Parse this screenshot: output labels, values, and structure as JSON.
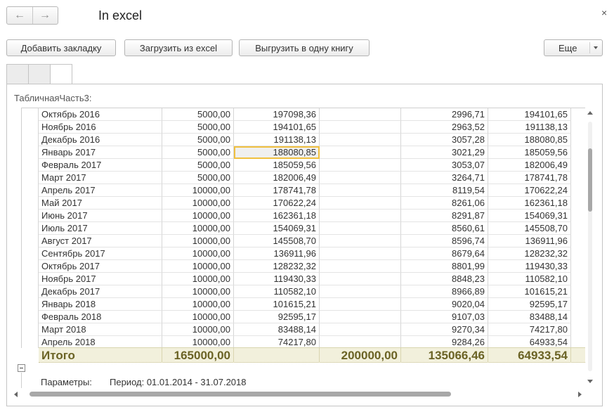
{
  "window": {
    "title": "In excel",
    "back_icon": "arrow-left-icon",
    "forward_icon": "arrow-right-icon",
    "close_glyph": "×"
  },
  "toolbar": {
    "add_bookmark": "Добавить закладку",
    "load_excel": "Загрузить из excel",
    "export_one_book": "Выгрузить в одну книгу",
    "more": "Еще"
  },
  "section": {
    "label": "ТабличнаяЧасть3:"
  },
  "table": {
    "rows": [
      [
        "Октябрь 2016",
        "5000,00",
        "197098,36",
        "",
        "2996,71",
        "194101,65"
      ],
      [
        "Ноябрь 2016",
        "5000,00",
        "194101,65",
        "",
        "2963,52",
        "191138,13"
      ],
      [
        "Декабрь 2016",
        "5000,00",
        "191138,13",
        "",
        "3057,28",
        "188080,85"
      ],
      [
        "Январь 2017",
        "5000,00",
        "188080,85",
        "",
        "3021,29",
        "185059,56"
      ],
      [
        "Февраль 2017",
        "5000,00",
        "185059,56",
        "",
        "3053,07",
        "182006,49"
      ],
      [
        "Март 2017",
        "5000,00",
        "182006,49",
        "",
        "3264,71",
        "178741,78"
      ],
      [
        "Апрель 2017",
        "10000,00",
        "178741,78",
        "",
        "8119,54",
        "170622,24"
      ],
      [
        "Май 2017",
        "10000,00",
        "170622,24",
        "",
        "8261,06",
        "162361,18"
      ],
      [
        "Июнь 2017",
        "10000,00",
        "162361,18",
        "",
        "8291,87",
        "154069,31"
      ],
      [
        "Июль 2017",
        "10000,00",
        "154069,31",
        "",
        "8560,61",
        "145508,70"
      ],
      [
        "Август 2017",
        "10000,00",
        "145508,70",
        "",
        "8596,74",
        "136911,96"
      ],
      [
        "Сентябрь 2017",
        "10000,00",
        "136911,96",
        "",
        "8679,64",
        "128232,32"
      ],
      [
        "Октябрь 2017",
        "10000,00",
        "128232,32",
        "",
        "8801,99",
        "119430,33"
      ],
      [
        "Ноябрь 2017",
        "10000,00",
        "119430,33",
        "",
        "8848,23",
        "110582,10"
      ],
      [
        "Декабрь 2017",
        "10000,00",
        "110582,10",
        "",
        "8966,89",
        "101615,21"
      ],
      [
        "Январь 2018",
        "10000,00",
        "101615,21",
        "",
        "9020,04",
        "92595,17"
      ],
      [
        "Февраль 2018",
        "10000,00",
        "92595,17",
        "",
        "9107,03",
        "83488,14"
      ],
      [
        "Март 2018",
        "10000,00",
        "83488,14",
        "",
        "9270,34",
        "74217,80"
      ],
      [
        "Апрель 2018",
        "10000,00",
        "74217,80",
        "",
        "9284,26",
        "64933,54"
      ]
    ],
    "selected": {
      "row": 3,
      "col": 2
    },
    "totals": {
      "label": "Итого",
      "col1": "165000,00",
      "col2": "",
      "col3": "200000,00",
      "col4": "135066,46",
      "col5": "64933,54"
    }
  },
  "footer": {
    "params_label": "Параметры:",
    "params_value": "Период: 01.01.2014 - 31.07.2018"
  },
  "colors": {
    "selection_border": "#f0c040",
    "totals_bg": "#f2f0dc",
    "totals_text": "#6b6325"
  }
}
